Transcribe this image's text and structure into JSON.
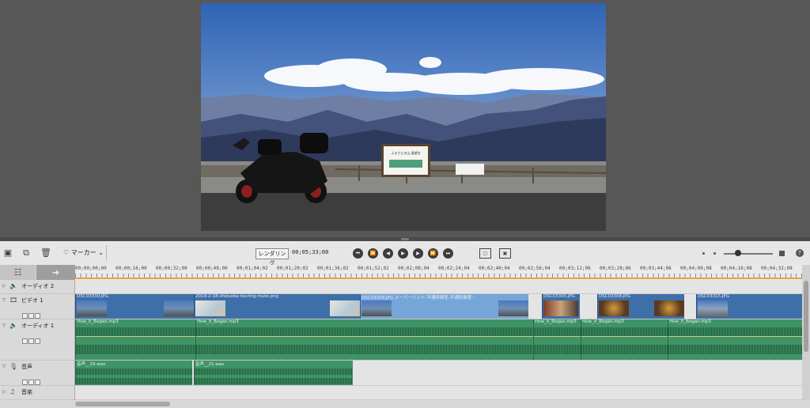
{
  "preview": {
    "sign_text": "ふるさとの山 展望台"
  },
  "toolbar": {
    "marker_label": "マーカー",
    "render_label": "レンダリング",
    "timecode": "00;05;33;00"
  },
  "ruler": {
    "ticks": [
      "00;00;00;00",
      "00;00;16;00",
      "00;00;32;00",
      "00;00;48;00",
      "00;01;04;02",
      "00;01;20;02",
      "00;01;36;02",
      "00;01;52;02",
      "00;02;08;04",
      "00;02;24;04",
      "00;02;40;04",
      "00;02;56;04",
      "00;03;12;06",
      "00;03;28;06",
      "00;03;44;06",
      "00;04;00;08",
      "00;04;16;08",
      "00;04;32;08"
    ]
  },
  "tracks": {
    "audio2": {
      "name": "オーディオ 2"
    },
    "video1": {
      "name": "ビデオ 1",
      "clip_titles": [
        "DSC03330.JPG",
        "2019-2-18-shizuoka-touring-route.png",
        "DSC03309.JPG スーパーバンド-不通時間差-不通時間差・",
        "DSC03305.JPG",
        "DSC03308.JPG",
        "DSC03315.JPG"
      ]
    },
    "audio1": {
      "name": "オーディオ 1",
      "clip_titles": [
        "How_it_Began.mp3",
        "How_it_Began.mp3",
        "How_it_Began.mp3",
        "How_it_Began.mp3",
        "How_it_Began.mp3"
      ]
    },
    "voice": {
      "name": "音声",
      "clip_titles": [
        "音声__19.wav",
        "音声__21.wav"
      ]
    },
    "music": {
      "name": "音楽"
    }
  }
}
